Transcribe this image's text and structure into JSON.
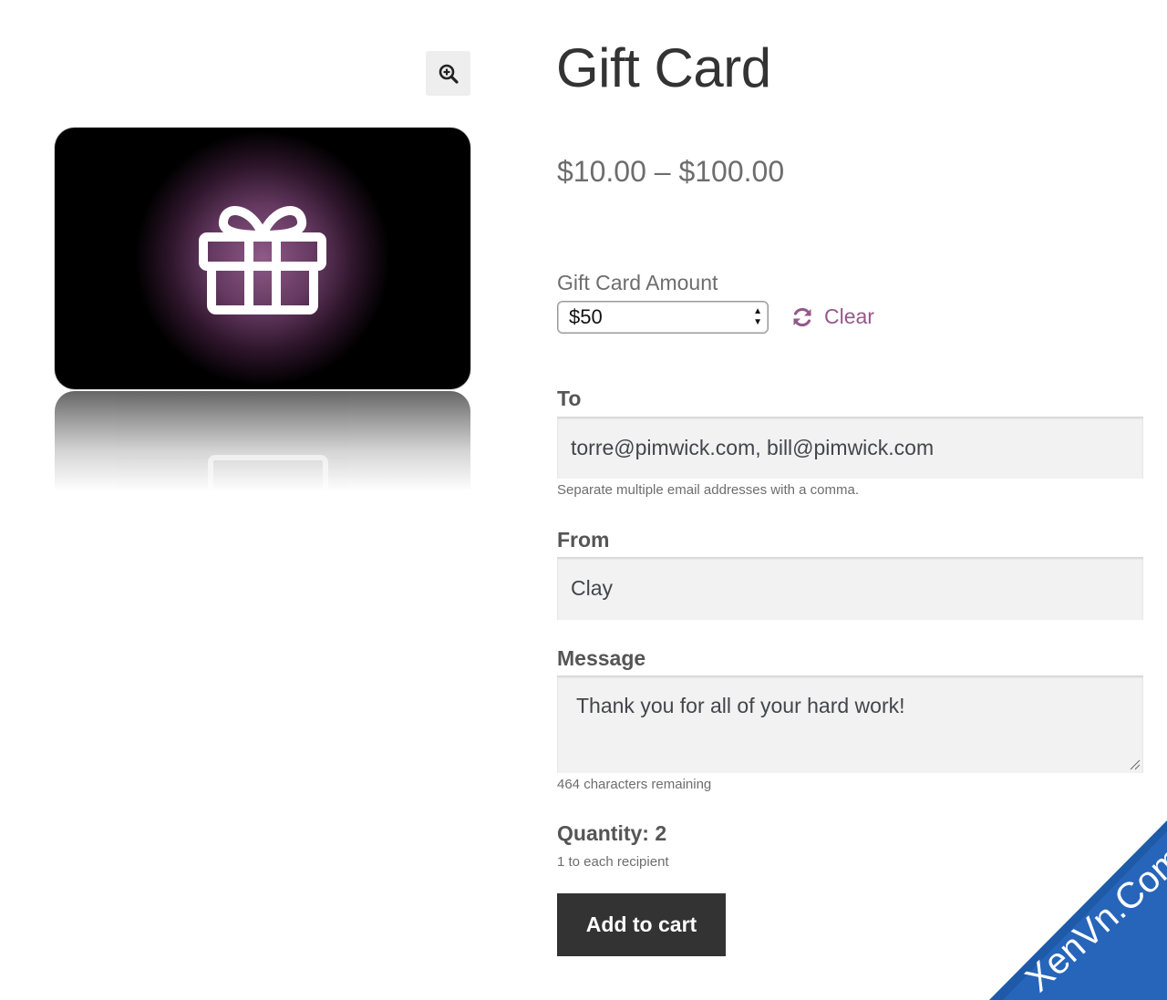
{
  "product": {
    "title": "Gift Card",
    "price_range": "$10.00 – $100.00",
    "zoom_icon": "magnify-plus-icon",
    "image_icon": "gift-icon"
  },
  "amount": {
    "label": "Gift Card Amount",
    "selected": "$50",
    "clear_label": "Clear",
    "clear_icon": "refresh-icon"
  },
  "to": {
    "label": "To",
    "value": "torre@pimwick.com, bill@pimwick.com",
    "hint": "Separate multiple email addresses with a comma."
  },
  "from": {
    "label": "From",
    "value": "Clay"
  },
  "message": {
    "label": "Message",
    "value": "Thank you for all of your hard work!",
    "remaining": "464 characters remaining"
  },
  "quantity": {
    "label": "Quantity: 2",
    "note": "1 to each recipient"
  },
  "cart": {
    "button_label": "Add to cart"
  },
  "watermark": {
    "text": "XenVn.Com"
  },
  "colors": {
    "accent": "#96588a",
    "button_bg": "#333333",
    "field_bg": "#f2f2f2"
  }
}
